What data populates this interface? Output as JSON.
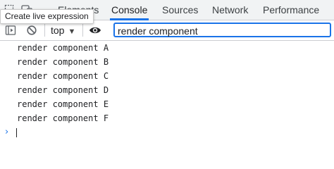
{
  "tooltip": "Create live expression",
  "tabs": [
    {
      "label": "Elements",
      "active": false
    },
    {
      "label": "Console",
      "active": true
    },
    {
      "label": "Sources",
      "active": false
    },
    {
      "label": "Network",
      "active": false
    },
    {
      "label": "Performance",
      "active": false
    }
  ],
  "toolbar": {
    "context": "top",
    "filter_value": "render component"
  },
  "messages": [
    "render component A",
    "render component B",
    "render component C",
    "render component D",
    "render component E",
    "render component F"
  ],
  "prompt": {
    "chevron": "›"
  },
  "colors": {
    "accent": "#1a73e8",
    "tabbar_bg": "#f1f3f4",
    "text": "#202124"
  },
  "icons": [
    "inspect-icon",
    "device-toolbar-icon",
    "sidebar-toggle-icon",
    "clear-console-icon",
    "live-expression-eye-icon",
    "chevron-down-icon"
  ]
}
